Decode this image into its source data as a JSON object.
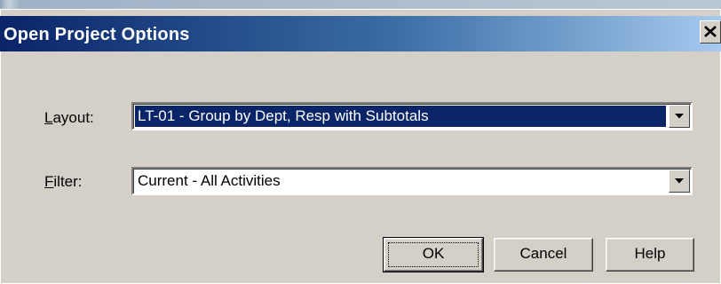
{
  "dialog": {
    "title": "Open Project Options"
  },
  "layout_field": {
    "label_underlined": "L",
    "label_rest": "ayout:",
    "value": "LT-01 - Group by Dept, Resp with Subtotals"
  },
  "filter_field": {
    "label_underlined": "F",
    "label_rest": "ilter:",
    "value": "Current - All Activities"
  },
  "buttons": {
    "ok": "OK",
    "cancel": "Cancel",
    "help": "Help"
  },
  "colors": {
    "title_bar_start": "#0a246a",
    "title_bar_end": "#a6caf0",
    "selection": "#0a246a",
    "dialog_face": "#d4d0c8"
  },
  "icons": {
    "close": "close-icon",
    "dropdown": "chevron-down-icon"
  }
}
